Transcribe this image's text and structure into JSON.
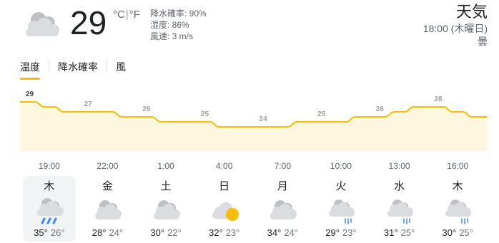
{
  "current": {
    "icon": "cloudy-icon",
    "temperature": "29",
    "unit_c": "°C",
    "unit_f": "°F",
    "precip": "降水確率: 90%",
    "humidity": "湿度: 86%",
    "wind": "風速: 3 m/s"
  },
  "header": {
    "title": "天気",
    "datetime": "18:00 (木曜日)",
    "condition": "曇"
  },
  "tabs": [
    {
      "label": "温度",
      "active": true
    },
    {
      "label": "降水確率",
      "active": false
    },
    {
      "label": "風",
      "active": false
    }
  ],
  "colors": {
    "accent": "#fbbc04",
    "fill": "#fef7e0",
    "text": "#202124",
    "muted": "#70757a",
    "selected_bg": "#f1f3f4"
  },
  "chart_data": {
    "type": "area",
    "x": [
      "18:00",
      "19:00",
      "20:00",
      "21:00",
      "22:00",
      "23:00",
      "0:00",
      "1:00",
      "2:00",
      "3:00",
      "4:00",
      "5:00",
      "6:00",
      "7:00",
      "8:00",
      "9:00",
      "10:00",
      "11:00",
      "12:00",
      "13:00",
      "14:00",
      "15:00",
      "16:00",
      "17:00"
    ],
    "values": [
      29,
      28,
      27,
      27,
      27,
      26,
      26,
      25,
      25,
      25,
      24,
      24,
      24,
      24,
      25,
      25,
      25,
      26,
      26,
      27,
      28,
      28,
      27,
      26
    ],
    "labeled_values": [
      {
        "x": "18:00",
        "value": "29"
      },
      {
        "x": "21:00",
        "value": "27"
      },
      {
        "x": "0:00",
        "value": "26"
      },
      {
        "x": "3:00",
        "value": "25"
      },
      {
        "x": "6:00",
        "value": "24"
      },
      {
        "x": "9:00",
        "value": "25"
      },
      {
        "x": "12:00",
        "value": "26"
      },
      {
        "x": "15:00",
        "value": "28"
      }
    ],
    "xticks": [
      "19:00",
      "22:00",
      "1:00",
      "4:00",
      "7:00",
      "10:00",
      "13:00",
      "16:00"
    ],
    "ylim": [
      21,
      30
    ]
  },
  "days": [
    {
      "name": "木",
      "icon": "rain-icon",
      "hi": "35°",
      "lo": "26°",
      "selected": true
    },
    {
      "name": "金",
      "icon": "cloudy-icon",
      "hi": "28°",
      "lo": "24°",
      "selected": false
    },
    {
      "name": "土",
      "icon": "cloudy-icon",
      "hi": "30°",
      "lo": "22°",
      "selected": false
    },
    {
      "name": "日",
      "icon": "partly-sunny-icon",
      "hi": "32°",
      "lo": "23°",
      "selected": false
    },
    {
      "name": "月",
      "icon": "cloudy-icon",
      "hi": "34°",
      "lo": "24°",
      "selected": false
    },
    {
      "name": "火",
      "icon": "showers-icon",
      "hi": "29°",
      "lo": "23°",
      "selected": false
    },
    {
      "name": "水",
      "icon": "showers-icon",
      "hi": "31°",
      "lo": "25°",
      "selected": false
    },
    {
      "name": "木",
      "icon": "showers-icon",
      "hi": "30°",
      "lo": "25°",
      "selected": false
    }
  ]
}
